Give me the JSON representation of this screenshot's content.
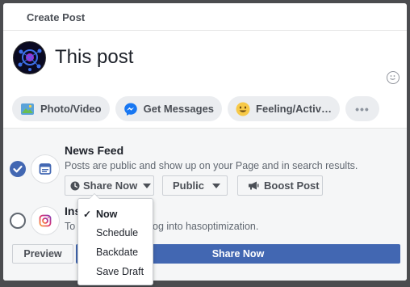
{
  "dialog": {
    "title": "Create Post",
    "post_text": "This post"
  },
  "actions": [
    {
      "label": "Photo/Video",
      "icon": "photo-icon"
    },
    {
      "label": "Get Messages",
      "icon": "messenger-icon"
    },
    {
      "label": "Feeling/Activ…",
      "icon": "smiley-icon"
    },
    {
      "label": "•••",
      "icon": "more-icon"
    }
  ],
  "news_feed": {
    "title": "News Feed",
    "description": "Posts are public and show up on your Page and in search results.",
    "checked": true,
    "share_now_label": "Share Now",
    "audience_label": "Public",
    "boost_label": "Boost Post"
  },
  "instagram": {
    "title_visible": "Ins",
    "description_start": "To",
    "description_end": "og into hasoptimization.",
    "checked": false
  },
  "footer": {
    "preview_label": "Preview",
    "share_label": "Share Now"
  },
  "schedule_menu": {
    "items": [
      "Now",
      "Schedule",
      "Backdate",
      "Save Draft"
    ],
    "selected": "Now",
    "check_glyph": "✓"
  },
  "colors": {
    "brand_blue": "#4267b2",
    "overlay": "#4b4c4f"
  }
}
